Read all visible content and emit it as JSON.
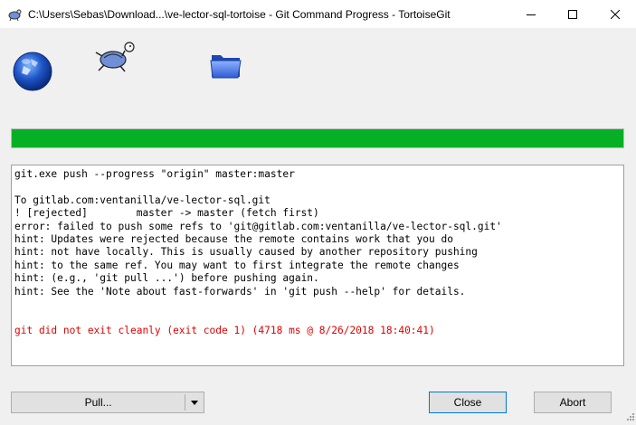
{
  "window": {
    "title": "C:\\Users\\Sebas\\Download...\\ve-lector-sql-tortoise - Git Command Progress - TortoiseGit"
  },
  "icons": {
    "app": "tortoisegit-icon",
    "logo_globe": "globe-icon",
    "logo_turtle": "tortoise-icon",
    "logo_folder": "folder-icon"
  },
  "progress": {
    "percent": 100,
    "color": "#06b025"
  },
  "log": {
    "lines": [
      "git.exe push --progress \"origin\" master:master",
      "",
      "To gitlab.com:ventanilla/ve-lector-sql.git",
      "! [rejected]        master -> master (fetch first)",
      "error: failed to push some refs to 'git@gitlab.com:ventanilla/ve-lector-sql.git'",
      "hint: Updates were rejected because the remote contains work that you do",
      "hint: not have locally. This is usually caused by another repository pushing",
      "hint: to the same ref. You may want to first integrate the remote changes",
      "hint: (e.g., 'git pull ...') before pushing again.",
      "hint: See the 'Note about fast-forwards' in 'git push --help' for details.",
      "",
      "",
      "git did not exit cleanly (exit code 1) (4718 ms @ 8/26/2018 18:40:41)"
    ],
    "error_color": "#e00000"
  },
  "buttons": {
    "pull": "Pull...",
    "close": "Close",
    "abort": "Abort"
  }
}
